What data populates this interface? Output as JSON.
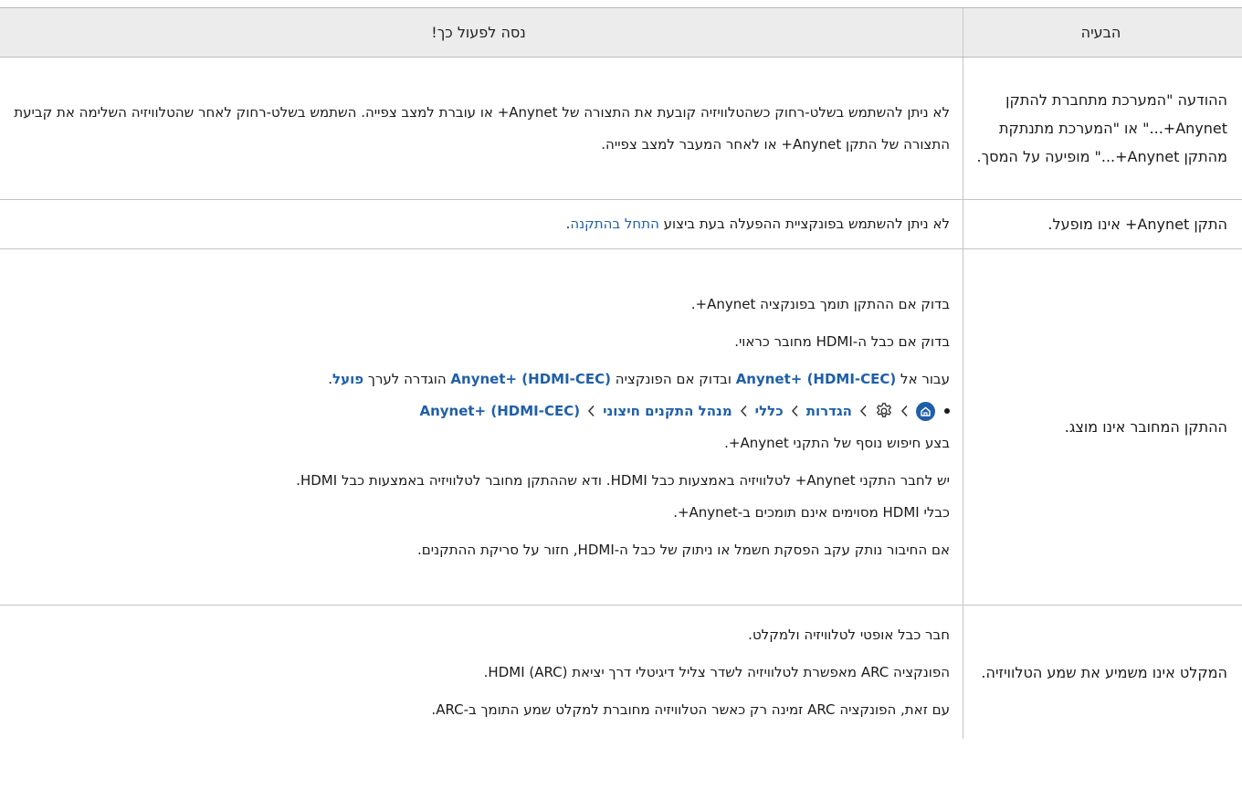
{
  "header": {
    "problem": "הבעיה",
    "solution": "נסה לפעול כך!"
  },
  "rows": [
    {
      "problem": "ההודעה \"המערכת מתחברת להתקן Anynet+...\" או \"המערכת מתנתקת מהתקן Anynet+...\" מופיעה על המסך.",
      "solution": "לא ניתן להשתמש בשלט-רחוק כשהטלוויזיה קובעת את התצורה של Anynet+ או עוברת למצב צפייה. השתמש בשלט-רחוק לאחר שהטלוויזיה השלימה את קביעת התצורה של התקן Anynet+ או לאחר המעבר למצב צפייה."
    },
    {
      "problem": "התקן Anynet+ אינו מופעל.",
      "solution_pre": "לא ניתן להשתמש בפונקציית ההפעלה בעת ביצוע ",
      "solution_link": "התחל בהתקנה",
      "solution_post": "."
    },
    {
      "problem": "ההתקן המחובר אינו מוצג.",
      "p1": "בדוק אם ההתקן תומך בפונקציה Anynet+.",
      "p2": "בדוק אם כבל ה-HDMI מחובר כראוי.",
      "p3_a": "עבור אל ",
      "p3_link1": "Anynet+ (HDMI-CEC)",
      "p3_b": " ובדוק אם הפונקציה ",
      "p3_link2": "Anynet+ (HDMI-CEC)",
      "p3_c": " הוגדרה לערך ",
      "p3_link3": "פועל",
      "p3_d": ".",
      "path": [
        "הגדרות",
        "כללי",
        "מנהל התקנים חיצוני",
        "Anynet+ (HDMI-CEC)"
      ],
      "p4": "בצע חיפוש נוסף של התקני Anynet+.",
      "p5_line1": "יש לחבר התקני Anynet+ לטלוויזיה באמצעות כבל HDMI. ודא שההתקן מחובר לטלוויזיה באמצעות כבל HDMI.",
      "p5_line2": "כבלי HDMI מסוימים אינם תומכים ב-Anynet+.",
      "p6": "אם החיבור נותק עקב הפסקת חשמל או ניתוק של כבל ה-HDMI, חזור על סריקת ההתקנים."
    },
    {
      "problem": "המקלט אינו משמיע את שמע הטלוויזיה.",
      "p1": "חבר כבל אופטי לטלוויזיה ולמקלט.",
      "p2": "הפונקציה ARC מאפשרת לטלוויזיה לשדר צליל דיגיטלי דרך יציאת HDMI (ARC).",
      "p3": "עם זאת, הפונקציה ARC זמינה רק כאשר הטלוויזיה מחוברת למקלט שמע התומך ב-ARC."
    }
  ],
  "colors": {
    "link": "#1f5fa8",
    "header_bg": "#ececec",
    "border": "#c4c4c4"
  },
  "icons": {
    "home": "home-icon",
    "settings": "gear-icon",
    "separator": "chevron-icon",
    "bullet": "bullet-dot"
  }
}
